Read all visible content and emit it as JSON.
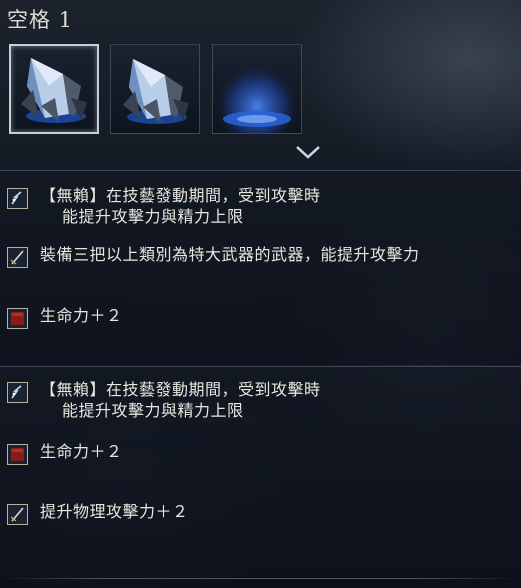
{
  "header": {
    "title": "空格 1"
  },
  "slots": [
    {
      "icon": "crystal-shard-icon",
      "selected": true
    },
    {
      "icon": "crystal-shard-icon",
      "selected": false
    },
    {
      "icon": "blue-glow-empty-icon",
      "selected": false
    }
  ],
  "groups": [
    {
      "effects": [
        {
          "icon": "lightning-skill-icon",
          "line1": "【無賴】在技藝發動期間，受到攻擊時",
          "line2": "能提升攻擊力與精力上限"
        },
        {
          "icon": "sword-icon",
          "line1": "裝備三把以上類別為特大武器的武器，能提升攻擊力",
          "line2": ""
        },
        {
          "icon": "red-vitality-icon",
          "line1": "生命力＋２",
          "line2": ""
        }
      ]
    },
    {
      "effects": [
        {
          "icon": "lightning-skill-icon",
          "line1": "【無賴】在技藝發動期間，受到攻擊時",
          "line2": "能提升攻擊力與精力上限"
        },
        {
          "icon": "red-vitality-icon",
          "line1": "生命力＋２",
          "line2": ""
        },
        {
          "icon": "sword-icon",
          "line1": "提升物理攻擊力＋２",
          "line2": ""
        }
      ]
    }
  ],
  "colors": {
    "accent_blue": "#4a8cff",
    "icon_border": "#b8b29a",
    "vitality_red": "#8b1a1a"
  }
}
